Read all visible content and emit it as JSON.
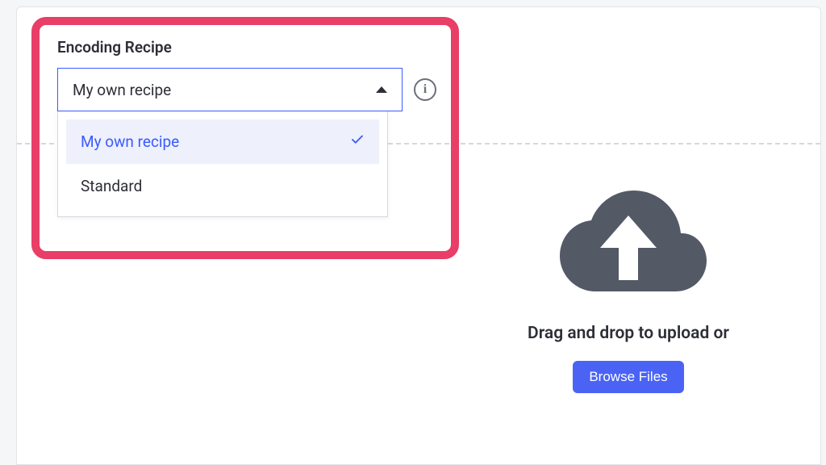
{
  "encoding": {
    "label": "Encoding Recipe",
    "selected": "My own recipe",
    "options": [
      {
        "label": "My own recipe",
        "selected": true
      },
      {
        "label": "Standard",
        "selected": false
      }
    ],
    "info_glyph": "i"
  },
  "upload": {
    "hint": "Drag and drop to upload or",
    "browse_label": "Browse Files"
  }
}
